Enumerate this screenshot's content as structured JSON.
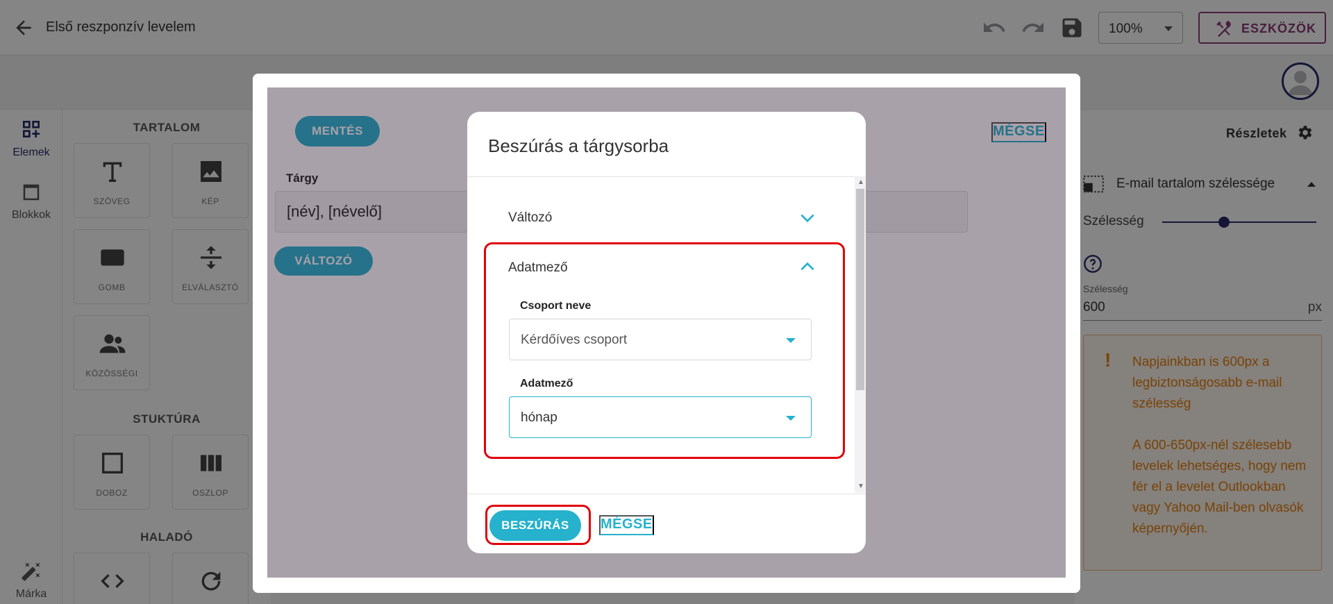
{
  "header": {
    "title": "Első reszponzív levelem",
    "zoom": "100%",
    "tools_label": "ESZKÖZÖK"
  },
  "rail": {
    "items": [
      {
        "label": "Elemek"
      },
      {
        "label": "Blokkok"
      },
      {
        "label": "Márka"
      }
    ]
  },
  "palette": {
    "content_heading": "TARTALOM",
    "structure_heading": "STUKTÚRA",
    "advanced_heading": "HALADÓ",
    "tiles": [
      {
        "label": "SZÖVEG"
      },
      {
        "label": "KÉP"
      },
      {
        "label": "GOMB"
      },
      {
        "label": "ELVÁLASZTÓ"
      },
      {
        "label": "KÖZÖSSÉGI"
      },
      {
        "label": "DOBOZ"
      },
      {
        "label": "OSZLOP"
      }
    ]
  },
  "right_panel": {
    "details_label": "Részletek",
    "section_title": "E-mail tartalom szélessége",
    "width_label": "Szélesség",
    "width_small_label": "Szélesség",
    "width_value": "600",
    "width_unit": "px",
    "slider_fraction": 0.4,
    "warning": {
      "paragraph1": "Napjainkban is 600px a legbiztonságosabb e-mail szélesség",
      "paragraph2": "A 600-650px-nél szélesebb levelek lehetséges, hogy nem fér el a levelet Outlookban vagy Yahoo Mail-ben olvasók képernyőjén."
    }
  },
  "subject_modal": {
    "save_label": "MENTÉS",
    "cancel_label": "MÉGSE",
    "subject_label": "Tárgy",
    "subject_value": "[név], [névelő]",
    "variable_button": "VÁLTOZÓ"
  },
  "insert_modal": {
    "title": "Beszúrás a tárgysorba",
    "accordion": [
      {
        "label": "Változó",
        "expanded": false
      },
      {
        "label": "Adatmező",
        "expanded": true
      }
    ],
    "group_label": "Csoport neve",
    "group_value": "Kérdőíves csoport",
    "field_label": "Adatmező",
    "field_value": "hónap",
    "insert_label": "BESZÚRÁS",
    "cancel_label": "MÉGSE"
  },
  "colors": {
    "accent": "#26b1cc",
    "brand": "#8b3a76",
    "warning": "#e6800e",
    "highlight": "#e0000a"
  }
}
